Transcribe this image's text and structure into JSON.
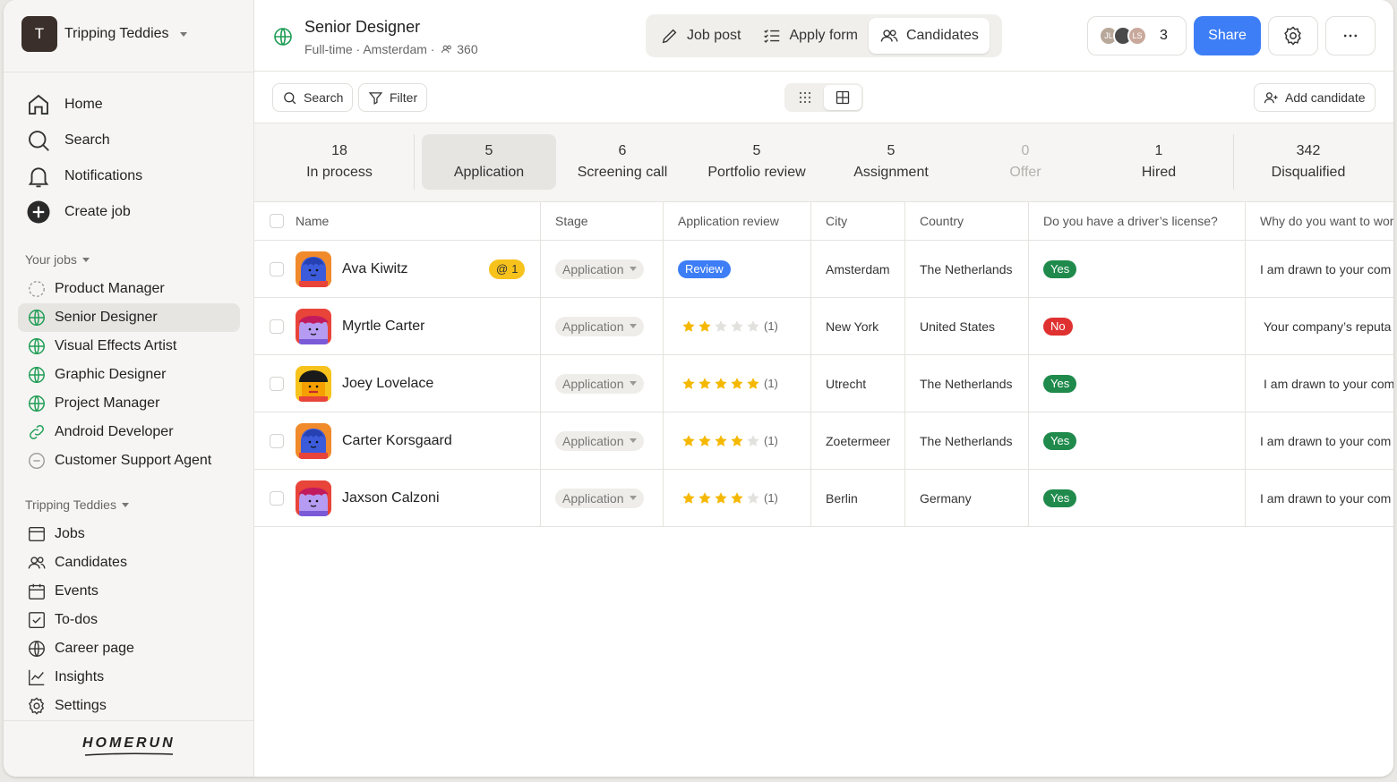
{
  "workspace": {
    "initial": "T",
    "name": "Tripping Teddies"
  },
  "nav": {
    "home": "Home",
    "search": "Search",
    "notifications": "Notifications",
    "create_job": "Create job"
  },
  "your_jobs": {
    "label": "Your jobs",
    "items": [
      {
        "name": "Product Manager",
        "status": "draft"
      },
      {
        "name": "Senior Designer",
        "status": "published",
        "active": true
      },
      {
        "name": "Visual Effects Artist",
        "status": "published"
      },
      {
        "name": "Graphic Designer",
        "status": "published"
      },
      {
        "name": "Project Manager",
        "status": "published"
      },
      {
        "name": "Android Developer",
        "status": "linked"
      },
      {
        "name": "Customer Support Agent",
        "status": "closed"
      }
    ]
  },
  "company": {
    "label": "Tripping Teddies",
    "items": [
      "Jobs",
      "Candidates",
      "Events",
      "To-dos",
      "Career page",
      "Insights",
      "Settings"
    ]
  },
  "brand": "HOMERUN",
  "job": {
    "title": "Senior Designer",
    "meta": "Full-time · Amsterdam ·",
    "count": "360"
  },
  "tabs": {
    "job_post": "Job post",
    "apply_form": "Apply form",
    "candidates": "Candidates"
  },
  "team": {
    "avatars": [
      "JL",
      "",
      "LS"
    ],
    "count": "3"
  },
  "share": "Share",
  "toolbar": {
    "search": "Search",
    "filter": "Filter",
    "add": "Add candidate"
  },
  "stages": [
    {
      "n": "18",
      "l": "In process"
    },
    {
      "n": "5",
      "l": "Application"
    },
    {
      "n": "6",
      "l": "Screening call"
    },
    {
      "n": "5",
      "l": "Portfolio review"
    },
    {
      "n": "5",
      "l": "Assignment"
    },
    {
      "n": "0",
      "l": "Offer"
    },
    {
      "n": "1",
      "l": "Hired"
    },
    {
      "n": "342",
      "l": "Disqualified"
    }
  ],
  "columns": {
    "name": "Name",
    "stage": "Stage",
    "review": "Application review",
    "city": "City",
    "country": "Country",
    "license": "Do you have a driver’s license?",
    "why": "Why do you want to wor"
  },
  "candidates": [
    {
      "name": "Ava Kiwitz",
      "mention": "1",
      "stage": "Application",
      "review": "Review",
      "city": "Amsterdam",
      "country": "The Netherlands",
      "license": "Yes",
      "why": "I am drawn to your com"
    },
    {
      "name": "Myrtle Carter",
      "stage": "Application",
      "rating": 2,
      "rating_count": "(1)",
      "city": "New York",
      "country": "United States",
      "license": "No",
      "why": "Your company’s reputa"
    },
    {
      "name": "Joey Lovelace",
      "stage": "Application",
      "rating": 5,
      "rating_count": "(1)",
      "city": "Utrecht",
      "country": "The Netherlands",
      "license": "Yes",
      "why": "I am drawn to your com"
    },
    {
      "name": "Carter Korsgaard",
      "stage": "Application",
      "rating": 4,
      "rating_count": "(1)",
      "city": "Zoetermeer",
      "country": "The Netherlands",
      "license": "Yes",
      "why": "I am drawn to your com"
    },
    {
      "name": "Jaxson Calzoni",
      "stage": "Application",
      "rating": 4,
      "rating_count": "(1)",
      "city": "Berlin",
      "country": "Germany",
      "license": "Yes",
      "why": "I am drawn to your com"
    }
  ],
  "colors": {
    "accent": "#3d7ef6",
    "yes": "#1f8a4c",
    "no": "#e03131",
    "globe": "#1f9d55",
    "star": "#f5b800"
  }
}
